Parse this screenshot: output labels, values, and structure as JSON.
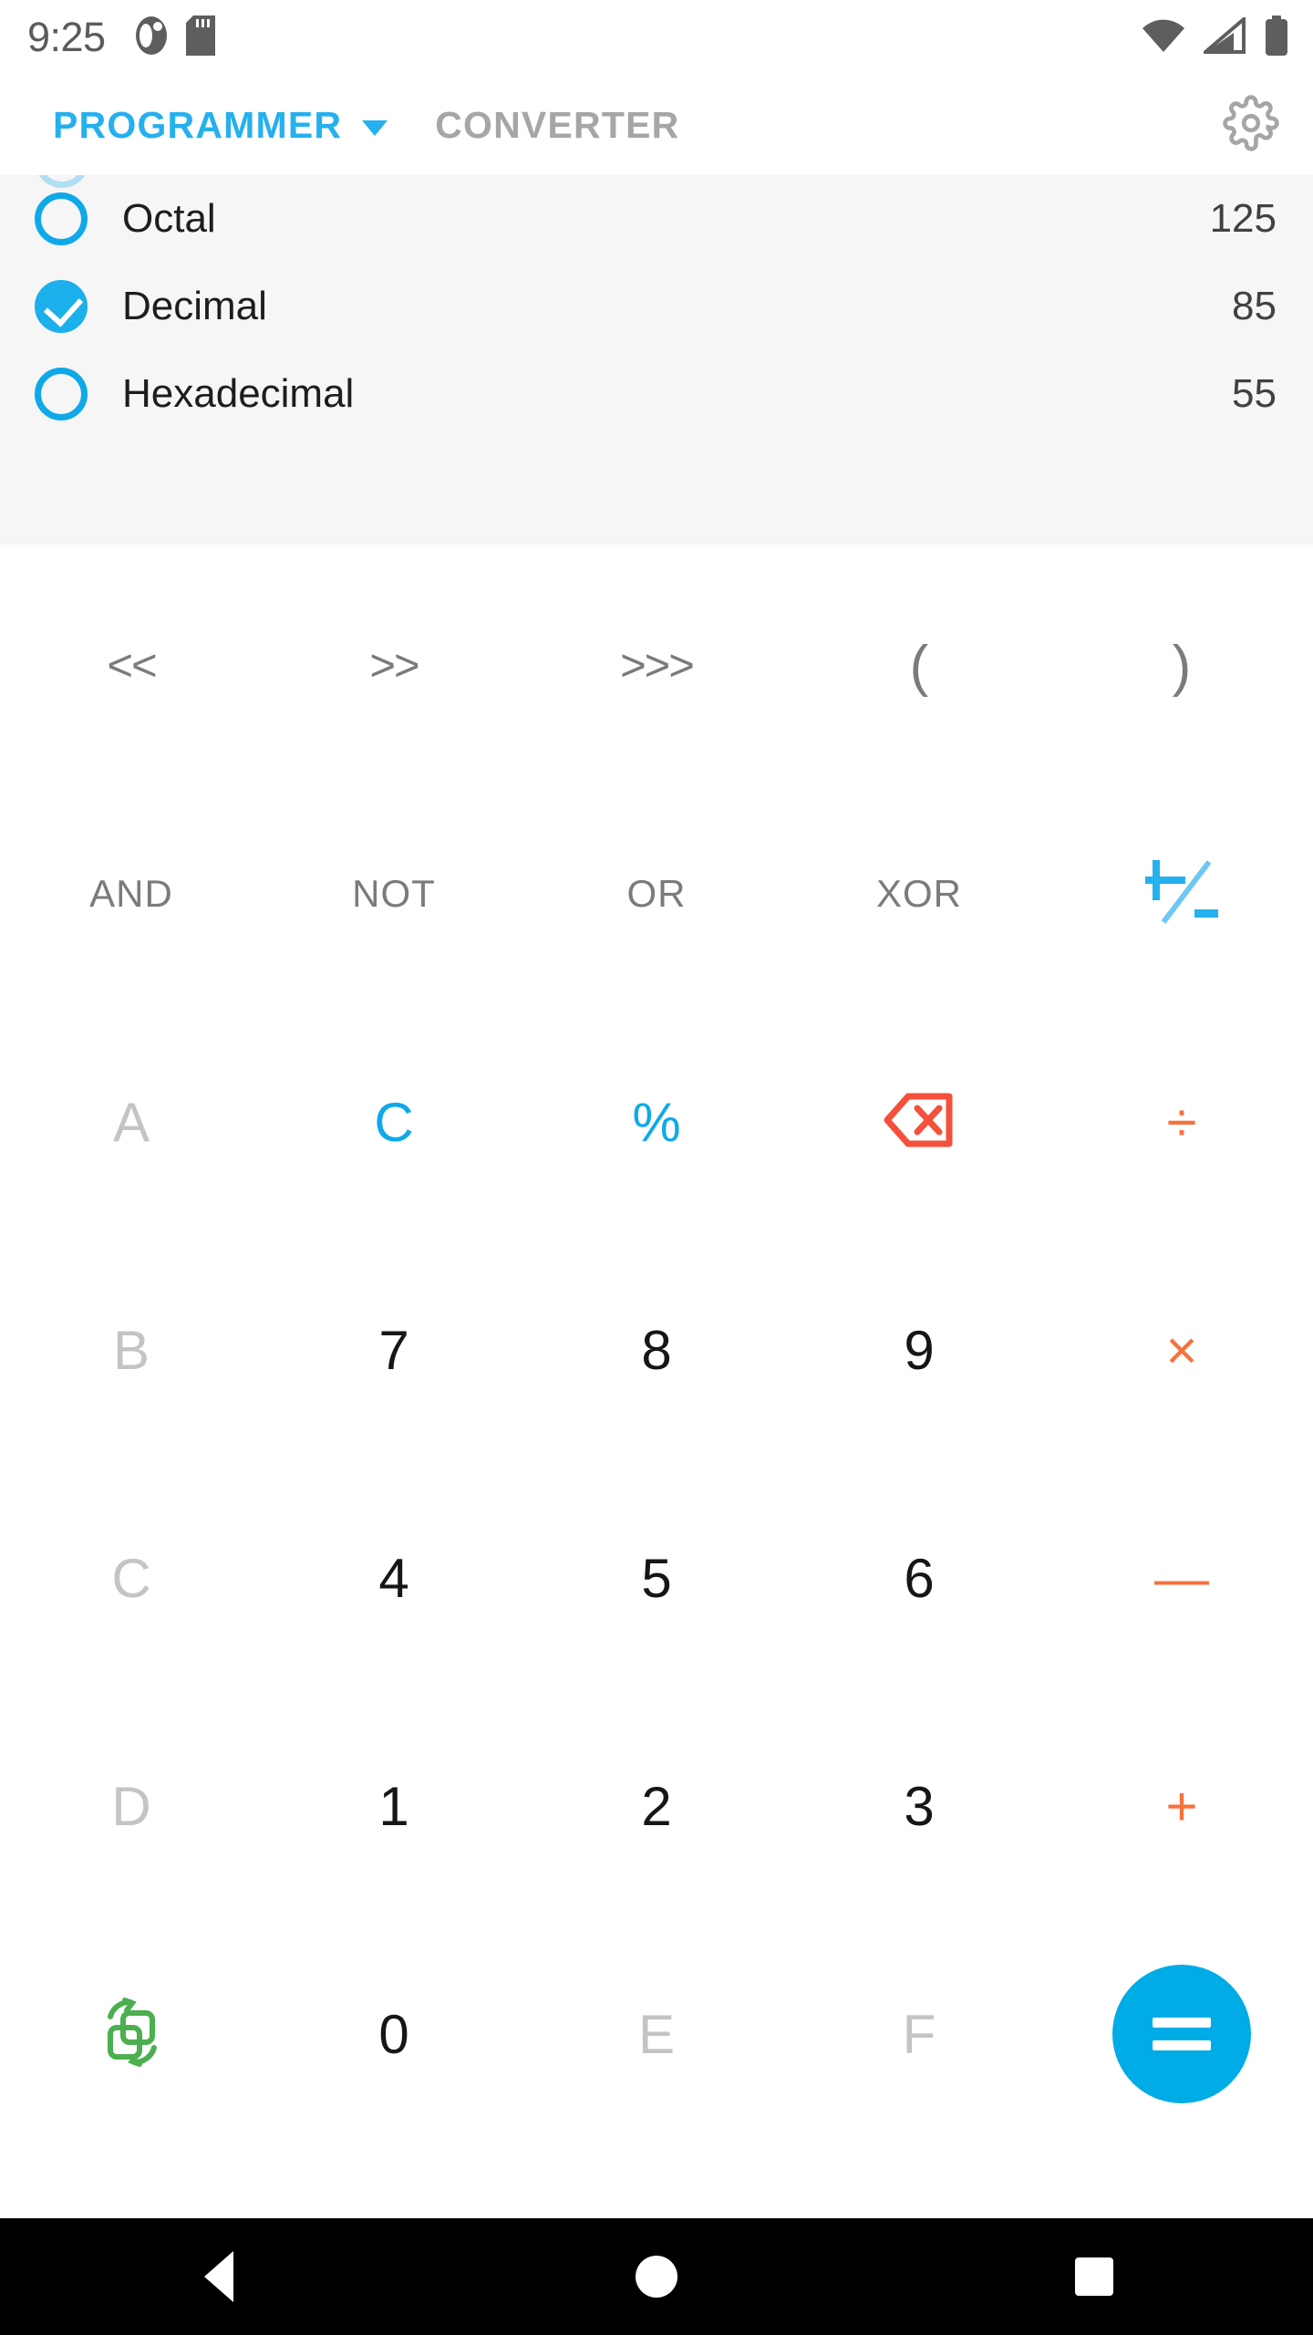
{
  "status_bar": {
    "time": "9:25",
    "left_icons": [
      "app-notification-icon",
      "sd-card-icon"
    ],
    "right_icons": [
      "wifi-icon",
      "cellular-signal-icon",
      "battery-icon"
    ]
  },
  "header": {
    "tab_active": "PROGRAMMER",
    "tab_inactive": "CONVERTER",
    "dropdown_icon": "chevron-down-icon",
    "settings_icon": "gear-icon"
  },
  "display": {
    "rows": [
      {
        "label": "Octal",
        "value": "125",
        "selected": false
      },
      {
        "label": "Decimal",
        "value": "85",
        "selected": true
      },
      {
        "label": "Hexadecimal",
        "value": "55",
        "selected": false
      }
    ]
  },
  "keypad": {
    "row_shift": [
      {
        "label": "<<",
        "name": "shift-left-key"
      },
      {
        "label": ">>",
        "name": "shift-right-key"
      },
      {
        "label": ">>>",
        "name": "unsigned-shift-right-key"
      },
      {
        "label": "(",
        "name": "open-paren-key"
      },
      {
        "label": ")",
        "name": "close-paren-key"
      }
    ],
    "row_logic": [
      {
        "label": "AND",
        "name": "and-key"
      },
      {
        "label": "NOT",
        "name": "not-key"
      },
      {
        "label": "OR",
        "name": "or-key"
      },
      {
        "label": "XOR",
        "name": "xor-key"
      },
      {
        "label": "",
        "name": "plus-minus-key"
      }
    ],
    "row_a": [
      {
        "label": "A",
        "name": "hex-a-key"
      },
      {
        "label": "C",
        "name": "clear-key"
      },
      {
        "label": "%",
        "name": "percent-key"
      },
      {
        "label": "",
        "name": "backspace-key"
      },
      {
        "label": "÷",
        "name": "divide-key"
      }
    ],
    "row_b": [
      {
        "label": "B",
        "name": "hex-b-key"
      },
      {
        "label": "7",
        "name": "digit-7-key"
      },
      {
        "label": "8",
        "name": "digit-8-key"
      },
      {
        "label": "9",
        "name": "digit-9-key"
      },
      {
        "label": "×",
        "name": "multiply-key"
      }
    ],
    "row_c": [
      {
        "label": "C",
        "name": "hex-c-key"
      },
      {
        "label": "4",
        "name": "digit-4-key"
      },
      {
        "label": "5",
        "name": "digit-5-key"
      },
      {
        "label": "6",
        "name": "digit-6-key"
      },
      {
        "label": "—",
        "name": "minus-key"
      }
    ],
    "row_d": [
      {
        "label": "D",
        "name": "hex-d-key"
      },
      {
        "label": "1",
        "name": "digit-1-key"
      },
      {
        "label": "2",
        "name": "digit-2-key"
      },
      {
        "label": "3",
        "name": "digit-3-key"
      },
      {
        "label": "+",
        "name": "plus-key"
      }
    ],
    "row_e": [
      {
        "label": "",
        "name": "convert-swap-key"
      },
      {
        "label": "0",
        "name": "digit-0-key"
      },
      {
        "label": "E",
        "name": "hex-e-key"
      },
      {
        "label": "F",
        "name": "hex-f-key"
      },
      {
        "label": "=",
        "name": "equals-key"
      }
    ]
  },
  "colors": {
    "accent_blue": "#25b0ee",
    "operator_orange": "#f7713c",
    "backspace_red": "#f4503c",
    "convert_green": "#4caf50",
    "disabled_gray": "#c4c4c4",
    "panel_bg": "#f6f6f7"
  },
  "nav_bar": {
    "back": "back-triangle-icon",
    "home": "home-circle-icon",
    "recents": "recents-square-icon"
  }
}
